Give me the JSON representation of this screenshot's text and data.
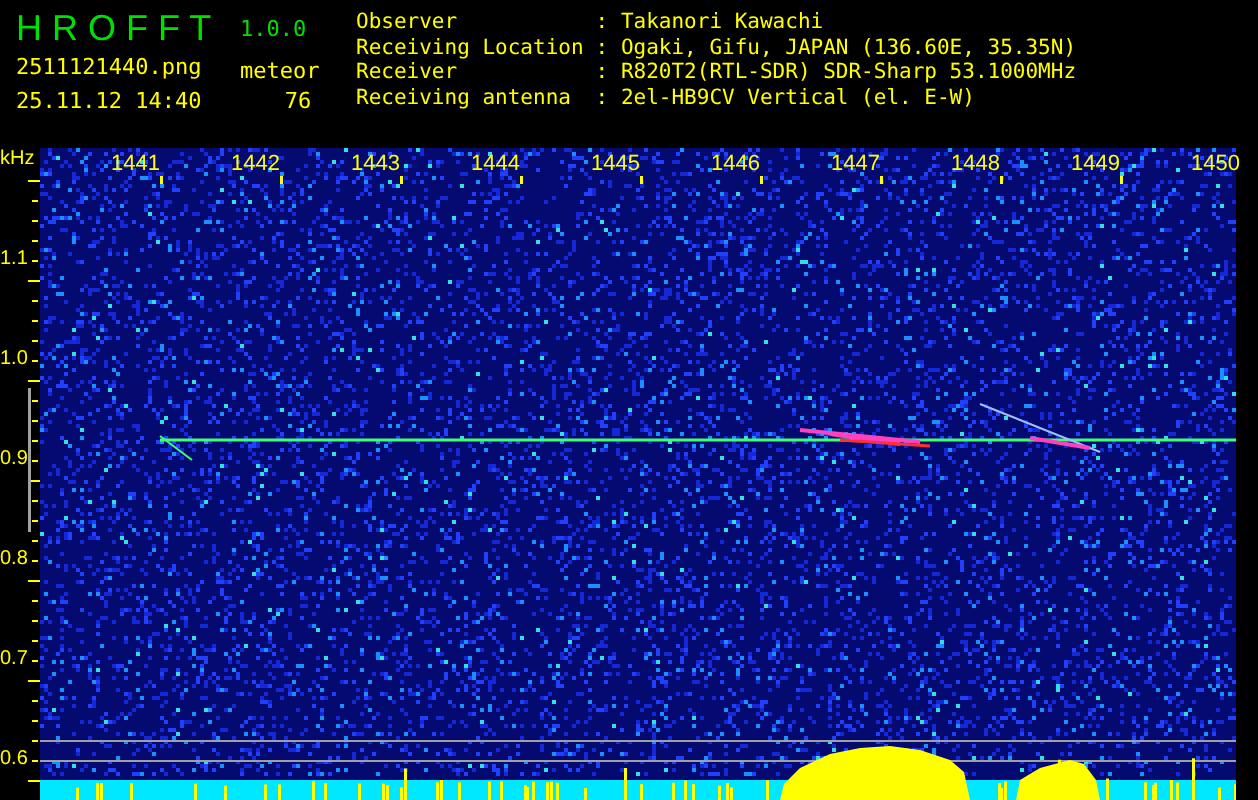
{
  "header": {
    "title": "H R O F F T",
    "version": "1.0.0",
    "file": "2511121440.png",
    "timestamp": "25.11.12 14:40",
    "count_label": "meteor",
    "count": "76"
  },
  "info": [
    {
      "label": "Observer",
      "value": ": Takanori Kawachi"
    },
    {
      "label": "Receiving Location",
      "value": ": Ogaki, Gifu, JAPAN (136.60E, 35.35N)"
    },
    {
      "label": "Receiver",
      "value": ": R820T2(RTL-SDR) SDR-Sharp 53.1000MHz"
    },
    {
      "label": "Receiving antenna",
      "value": ": 2el-HB9CV Vertical (el. E-W)"
    }
  ],
  "axes": {
    "y_unit": "kHz",
    "x_ticks": [
      "1441",
      "1442",
      "1443",
      "1444",
      "1445",
      "1446",
      "1447",
      "1448",
      "1449",
      "1450"
    ],
    "y_ticks": [
      "1.1",
      "1.0",
      "0.9",
      "0.8",
      "0.7",
      "0.6"
    ]
  }
}
